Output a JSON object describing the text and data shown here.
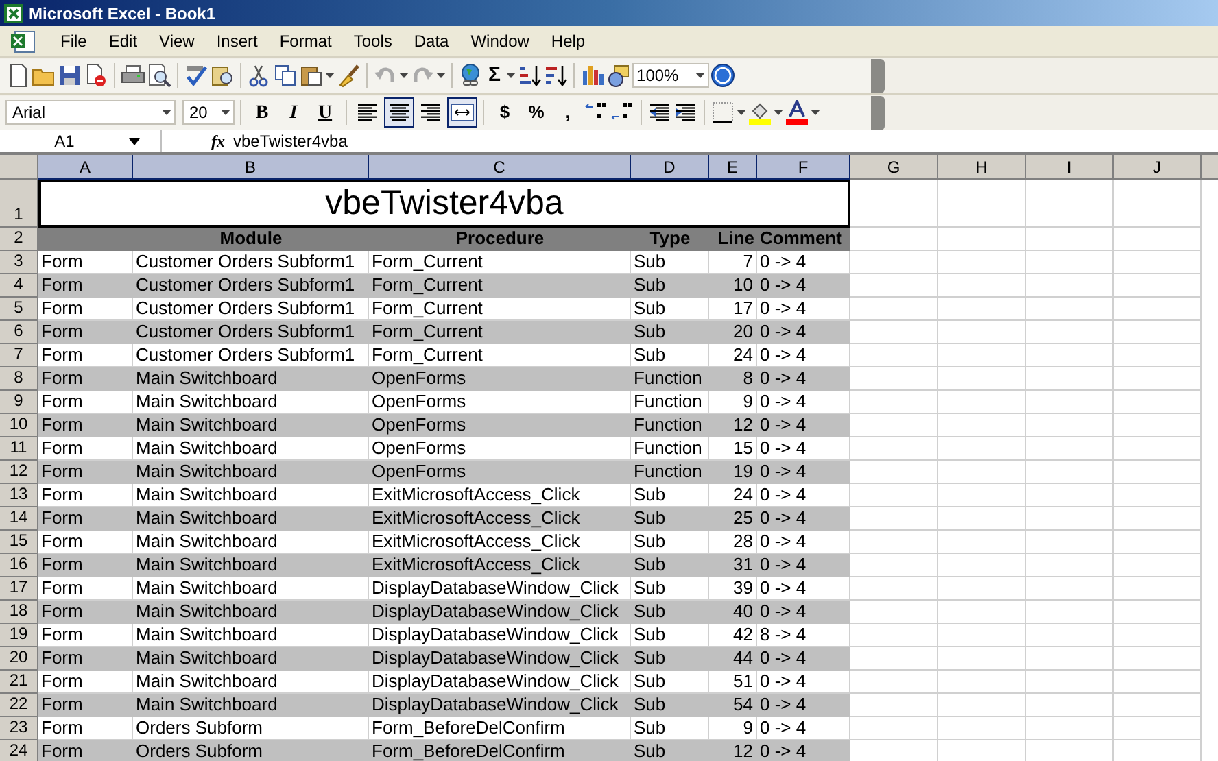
{
  "window": {
    "title": "Microsoft Excel - Book1"
  },
  "menu": [
    "File",
    "Edit",
    "View",
    "Insert",
    "Format",
    "Tools",
    "Data",
    "Window",
    "Help"
  ],
  "standard_toolbar": {
    "autosum": "Σ",
    "zoom": "100%"
  },
  "formatting_toolbar": {
    "font": "Arial",
    "size": "20",
    "buttons": [
      {
        "kind": "bold",
        "label": "B",
        "selected": false
      },
      {
        "kind": "italic",
        "label": "I",
        "selected": false
      },
      {
        "kind": "underline",
        "label": "U",
        "selected": false
      },
      {
        "kind": "align_left",
        "selected": false
      },
      {
        "kind": "align_center",
        "selected": true
      },
      {
        "kind": "align_right",
        "selected": false
      },
      {
        "kind": "merge",
        "selected": true
      },
      {
        "kind": "currency",
        "label": "$",
        "selected": false
      },
      {
        "kind": "percent",
        "label": "%",
        "selected": false
      },
      {
        "kind": "comma",
        "label": ",",
        "selected": false
      }
    ]
  },
  "formula_bar": {
    "name_box": "A1",
    "fx": "fx",
    "value": "vbeTwister4vba"
  },
  "columns": [
    {
      "label": "A",
      "selected": true
    },
    {
      "label": "B",
      "selected": true
    },
    {
      "label": "C",
      "selected": true
    },
    {
      "label": "D",
      "selected": true
    },
    {
      "label": "E",
      "selected": true
    },
    {
      "label": "F",
      "selected": true
    },
    {
      "label": "G",
      "selected": false
    },
    {
      "label": "H",
      "selected": false
    },
    {
      "label": "I",
      "selected": false
    },
    {
      "label": "J",
      "selected": false
    }
  ],
  "sheet": {
    "title_row": {
      "number": "1",
      "text": "vbeTwister4vba"
    },
    "header_row": {
      "number": "2",
      "cells": [
        "",
        "Module",
        "Procedure",
        "Type",
        "Line",
        "Comment"
      ]
    },
    "rows": [
      {
        "number": "3",
        "shaded": false,
        "cells": [
          "Form",
          "Customer Orders Subform1",
          "Form_Current",
          "Sub",
          "7",
          "0 -> 4"
        ]
      },
      {
        "number": "4",
        "shaded": true,
        "cells": [
          "Form",
          "Customer Orders Subform1",
          "Form_Current",
          "Sub",
          "10",
          "0 -> 4"
        ]
      },
      {
        "number": "5",
        "shaded": false,
        "cells": [
          "Form",
          "Customer Orders Subform1",
          "Form_Current",
          "Sub",
          "17",
          "0 -> 4"
        ]
      },
      {
        "number": "6",
        "shaded": true,
        "cells": [
          "Form",
          "Customer Orders Subform1",
          "Form_Current",
          "Sub",
          "20",
          "0 -> 4"
        ]
      },
      {
        "number": "7",
        "shaded": false,
        "cells": [
          "Form",
          "Customer Orders Subform1",
          "Form_Current",
          "Sub",
          "24",
          "0 -> 4"
        ]
      },
      {
        "number": "8",
        "shaded": true,
        "cells": [
          "Form",
          "Main Switchboard",
          "OpenForms",
          "Function",
          "8",
          "0 -> 4"
        ]
      },
      {
        "number": "9",
        "shaded": false,
        "cells": [
          "Form",
          "Main Switchboard",
          "OpenForms",
          "Function",
          "9",
          "0 -> 4"
        ]
      },
      {
        "number": "10",
        "shaded": true,
        "cells": [
          "Form",
          "Main Switchboard",
          "OpenForms",
          "Function",
          "12",
          "0 -> 4"
        ]
      },
      {
        "number": "11",
        "shaded": false,
        "cells": [
          "Form",
          "Main Switchboard",
          "OpenForms",
          "Function",
          "15",
          "0 -> 4"
        ]
      },
      {
        "number": "12",
        "shaded": true,
        "cells": [
          "Form",
          "Main Switchboard",
          "OpenForms",
          "Function",
          "19",
          "0 -> 4"
        ]
      },
      {
        "number": "13",
        "shaded": false,
        "cells": [
          "Form",
          "Main Switchboard",
          "ExitMicrosoftAccess_Click",
          "Sub",
          "24",
          "0 -> 4"
        ]
      },
      {
        "number": "14",
        "shaded": true,
        "cells": [
          "Form",
          "Main Switchboard",
          "ExitMicrosoftAccess_Click",
          "Sub",
          "25",
          "0 -> 4"
        ]
      },
      {
        "number": "15",
        "shaded": false,
        "cells": [
          "Form",
          "Main Switchboard",
          "ExitMicrosoftAccess_Click",
          "Sub",
          "28",
          "0 -> 4"
        ]
      },
      {
        "number": "16",
        "shaded": true,
        "cells": [
          "Form",
          "Main Switchboard",
          "ExitMicrosoftAccess_Click",
          "Sub",
          "31",
          "0 -> 4"
        ]
      },
      {
        "number": "17",
        "shaded": false,
        "cells": [
          "Form",
          "Main Switchboard",
          "DisplayDatabaseWindow_Click",
          "Sub",
          "39",
          "0 -> 4"
        ]
      },
      {
        "number": "18",
        "shaded": true,
        "cells": [
          "Form",
          "Main Switchboard",
          "DisplayDatabaseWindow_Click",
          "Sub",
          "40",
          "0 -> 4"
        ]
      },
      {
        "number": "19",
        "shaded": false,
        "cells": [
          "Form",
          "Main Switchboard",
          "DisplayDatabaseWindow_Click",
          "Sub",
          "42",
          "8 -> 4"
        ]
      },
      {
        "number": "20",
        "shaded": true,
        "cells": [
          "Form",
          "Main Switchboard",
          "DisplayDatabaseWindow_Click",
          "Sub",
          "44",
          "0 -> 4"
        ]
      },
      {
        "number": "21",
        "shaded": false,
        "cells": [
          "Form",
          "Main Switchboard",
          "DisplayDatabaseWindow_Click",
          "Sub",
          "51",
          "0 -> 4"
        ]
      },
      {
        "number": "22",
        "shaded": true,
        "cells": [
          "Form",
          "Main Switchboard",
          "DisplayDatabaseWindow_Click",
          "Sub",
          "54",
          "0 -> 4"
        ]
      },
      {
        "number": "23",
        "shaded": false,
        "cells": [
          "Form",
          "Orders Subform",
          "Form_BeforeDelConfirm",
          "Sub",
          "9",
          "0 -> 4"
        ]
      },
      {
        "number": "24",
        "shaded": true,
        "cells": [
          "Form",
          "Orders Subform",
          "Form_BeforeDelConfirm",
          "Sub",
          "12",
          "0 -> 4"
        ]
      }
    ]
  }
}
